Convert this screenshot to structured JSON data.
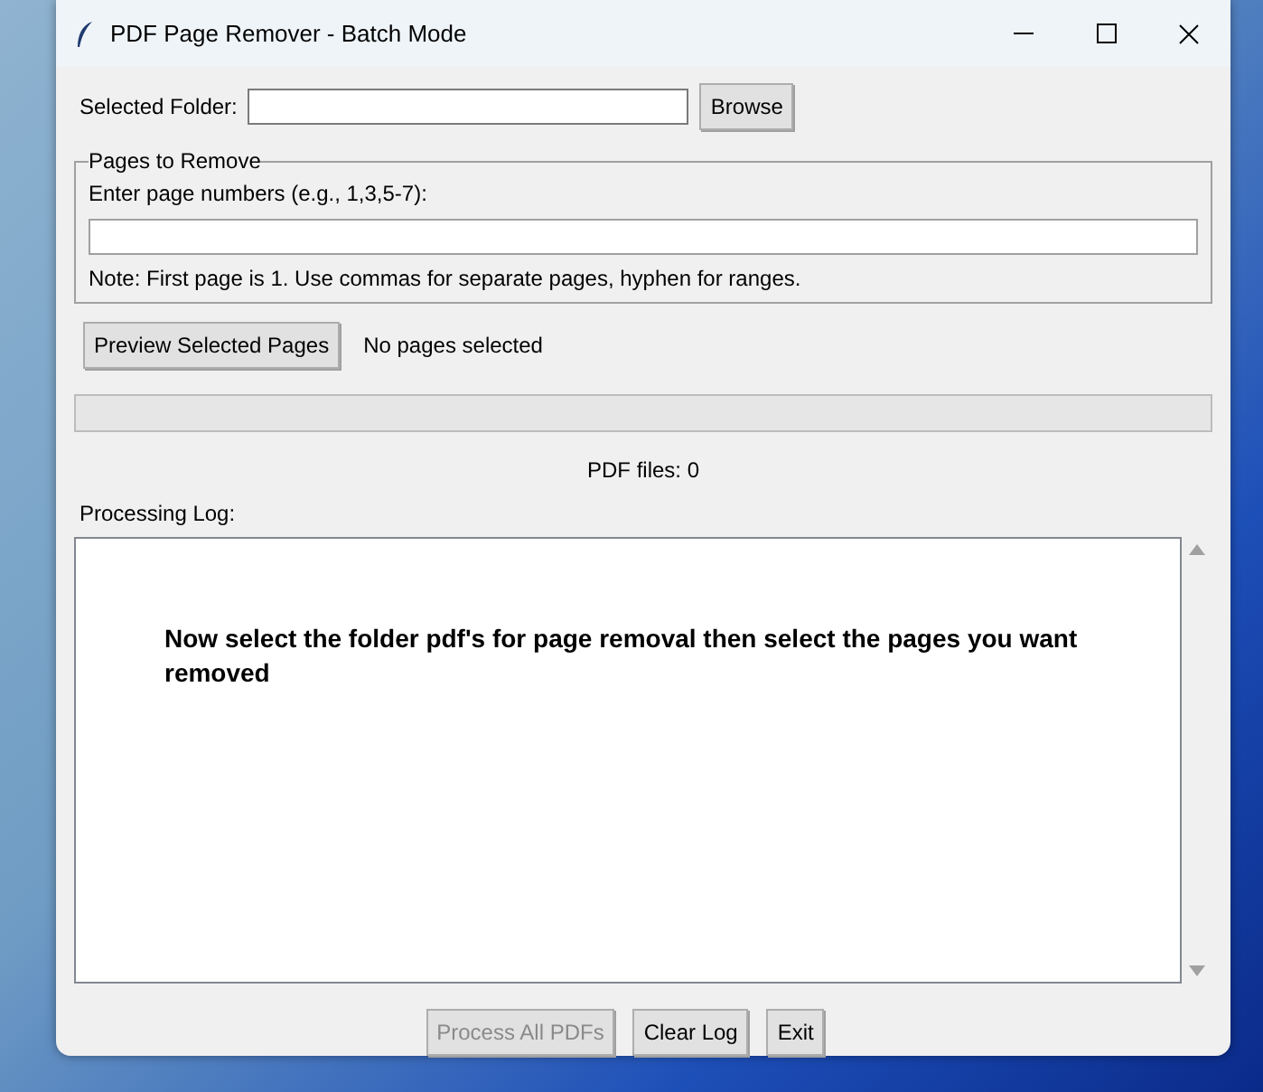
{
  "window": {
    "title": "PDF Page Remover - Batch Mode"
  },
  "folder": {
    "label": "Selected Folder:",
    "button": "Browse"
  },
  "pages_group": {
    "title": "Pages to Remove",
    "prompt": "Enter page numbers (e.g., 1,3,5-7):",
    "note": "Note: First page is 1. Use commas for separate pages, hyphen for ranges."
  },
  "preview": {
    "button": "Preview Selected Pages",
    "status": "No pages selected"
  },
  "progress": {
    "level": 0
  },
  "pdf_count": "PDF files: 0",
  "log": {
    "label": "Processing Log:",
    "text": "Now select the folder pdf's for page removal then select the pages you want removed"
  },
  "buttons": [
    {
      "label": "Process All PDFs",
      "disabled": true
    },
    {
      "label": "Clear Log",
      "disabled": false
    },
    {
      "label": "Exit",
      "disabled": false
    }
  ]
}
